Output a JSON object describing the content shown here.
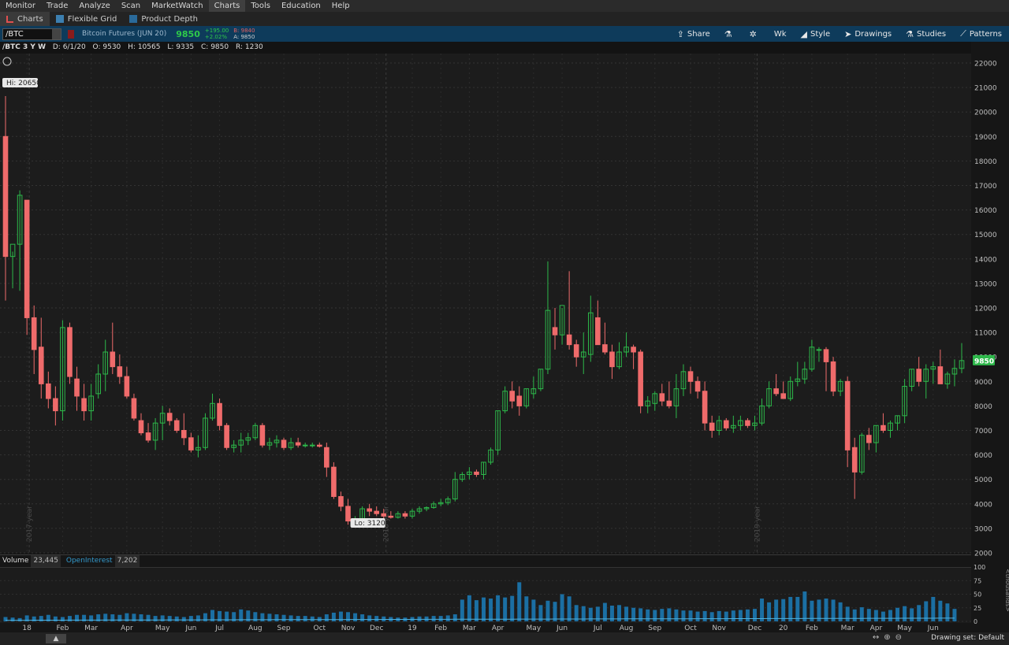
{
  "menu": [
    "Monitor",
    "Trade",
    "Analyze",
    "Scan",
    "MarketWatch",
    "Charts",
    "Tools",
    "Education",
    "Help"
  ],
  "menu_active": "Charts",
  "subtabs": [
    "Charts",
    "Flexible Grid",
    "Product Depth"
  ],
  "symbol": "/BTC",
  "description": "Bitcoin Futures (JUN 20)",
  "last_price": "9850",
  "net_change": "+195.00",
  "pct_change": "+2.02%",
  "bid": "B: 9840",
  "ask": "A: 9850",
  "toolbar": {
    "share": "Share",
    "aggregation": "Wk",
    "style": "Style",
    "drawings": "Drawings",
    "studies": "Studies",
    "patterns": "Patterns"
  },
  "info": {
    "title": "/BTC 3 Y W",
    "date": "D: 6/1/20",
    "open": "O: 9530",
    "high": "H: 10565",
    "low": "L: 9335",
    "close": "C: 9850",
    "range": "R: 1230"
  },
  "volume_label": "Volume",
  "volume_value": "23,445",
  "oi_label": "OpenInterest",
  "oi_value": "7,202",
  "drawing_set": "Drawing set: Default",
  "colors": {
    "up": "#2db84a",
    "down": "#ef6b6b",
    "volume": "#1b6fa3",
    "background": "#1c1c1c",
    "last_tag": "#2db84a"
  },
  "chart_data": {
    "type": "candlestick",
    "price_axis": {
      "min": 2000,
      "max": 22000,
      "ticks": [
        2000,
        3000,
        4000,
        5000,
        6000,
        7000,
        8000,
        9000,
        10000,
        11000,
        12000,
        13000,
        14000,
        15000,
        16000,
        17000,
        18000,
        19000,
        20000,
        21000,
        22000
      ]
    },
    "volume_axis": {
      "min": 0,
      "max": 100,
      "ticks": [
        0,
        25,
        50,
        75,
        100
      ],
      "unit_label": "<thousands>"
    },
    "time_labels": [
      "18",
      "Feb",
      "Mar",
      "Apr",
      "May",
      "Jun",
      "Jul",
      "Aug",
      "Sep",
      "Oct",
      "Nov",
      "Dec",
      "19",
      "Feb",
      "Mar",
      "Apr",
      "May",
      "Jun",
      "Jul",
      "Aug",
      "Sep",
      "Oct",
      "Nov",
      "Dec",
      "20",
      "Feb",
      "Mar",
      "Apr",
      "May",
      "Jun"
    ],
    "year_labels": [
      "2017 year",
      "2018 year",
      "2019 year"
    ],
    "annotations": {
      "high": "Hi: 20650",
      "low": "Lo: 3120",
      "last": "9850"
    },
    "candles": [
      [
        19000,
        20650,
        12300,
        14100
      ],
      [
        14100,
        14300,
        12800,
        14600
      ],
      [
        14600,
        16800,
        12700,
        16600
      ],
      [
        16400,
        16400,
        10900,
        11600
      ],
      [
        11600,
        12100,
        9300,
        10300
      ],
      [
        10400,
        11600,
        8300,
        8900
      ],
      [
        8900,
        9400,
        7900,
        8300
      ],
      [
        8300,
        8800,
        7200,
        7800
      ],
      [
        7800,
        11500,
        7400,
        11200
      ],
      [
        11200,
        11400,
        8900,
        9200
      ],
      [
        9100,
        9600,
        7800,
        8400
      ],
      [
        8300,
        8900,
        7400,
        7800
      ],
      [
        7800,
        8900,
        7400,
        8400
      ],
      [
        8500,
        9700,
        8300,
        9300
      ],
      [
        9300,
        10700,
        8600,
        10200
      ],
      [
        10200,
        11400,
        9300,
        9600
      ],
      [
        9600,
        10100,
        8900,
        9200
      ],
      [
        9200,
        9600,
        8300,
        8400
      ],
      [
        8300,
        8500,
        7400,
        7500
      ],
      [
        7400,
        7700,
        6800,
        6900
      ],
      [
        6900,
        7300,
        6500,
        6600
      ],
      [
        6600,
        7500,
        6200,
        7300
      ],
      [
        7300,
        8000,
        6600,
        7700
      ],
      [
        7700,
        7900,
        7200,
        7400
      ],
      [
        7400,
        7500,
        6900,
        7000
      ],
      [
        7000,
        7700,
        6400,
        6700
      ],
      [
        6700,
        6900,
        6100,
        6200
      ],
      [
        6200,
        6800,
        5900,
        6300
      ],
      [
        6300,
        7700,
        6200,
        7500
      ],
      [
        7500,
        8500,
        7400,
        8100
      ],
      [
        8100,
        8300,
        7000,
        7200
      ],
      [
        7200,
        7300,
        6200,
        6300
      ],
      [
        6300,
        6600,
        6100,
        6400
      ],
      [
        6400,
        6900,
        6100,
        6600
      ],
      [
        6600,
        6900,
        6400,
        6700
      ],
      [
        6700,
        7300,
        6600,
        7200
      ],
      [
        7200,
        7300,
        6300,
        6400
      ],
      [
        6400,
        6700,
        6200,
        6500
      ],
      [
        6500,
        6800,
        6300,
        6600
      ],
      [
        6600,
        6700,
        6200,
        6300
      ],
      [
        6300,
        6700,
        6200,
        6500
      ],
      [
        6500,
        6700,
        6300,
        6400
      ],
      [
        6400,
        6500,
        6300,
        6400
      ],
      [
        6400,
        6500,
        6300,
        6400
      ],
      [
        6400,
        6500,
        6300,
        6350
      ],
      [
        6300,
        6500,
        5100,
        5500
      ],
      [
        5500,
        5700,
        4200,
        4300
      ],
      [
        4300,
        4500,
        3700,
        3900
      ],
      [
        3900,
        4200,
        3150,
        3300
      ],
      [
        3300,
        3500,
        3120,
        3400
      ],
      [
        3400,
        3900,
        3300,
        3800
      ],
      [
        3800,
        4000,
        3500,
        3700
      ],
      [
        3700,
        3900,
        3500,
        3600
      ],
      [
        3600,
        3800,
        3400,
        3500
      ],
      [
        3500,
        3700,
        3400,
        3450
      ],
      [
        3450,
        3700,
        3400,
        3600
      ],
      [
        3600,
        3700,
        3400,
        3500
      ],
      [
        3500,
        3800,
        3400,
        3700
      ],
      [
        3700,
        3900,
        3600,
        3800
      ],
      [
        3800,
        3900,
        3700,
        3850
      ],
      [
        3850,
        4100,
        3800,
        4000
      ],
      [
        4000,
        4200,
        3900,
        4050
      ],
      [
        4050,
        4300,
        3950,
        4200
      ],
      [
        4200,
        5300,
        4100,
        5000
      ],
      [
        5000,
        5300,
        4900,
        5200
      ],
      [
        5200,
        5500,
        5000,
        5300
      ],
      [
        5300,
        5400,
        5100,
        5200
      ],
      [
        5200,
        5700,
        5000,
        5700
      ],
      [
        5700,
        6300,
        5600,
        6200
      ],
      [
        6200,
        7800,
        6000,
        7800
      ],
      [
        7800,
        8800,
        7700,
        8600
      ],
      [
        8600,
        9000,
        7900,
        8200
      ],
      [
        8400,
        8800,
        7600,
        8000
      ],
      [
        8000,
        8700,
        7900,
        8700
      ],
      [
        8500,
        9200,
        8300,
        8700
      ],
      [
        8700,
        9500,
        8600,
        9500
      ],
      [
        9500,
        13900,
        9300,
        11900
      ],
      [
        11200,
        12000,
        10300,
        10900
      ],
      [
        10900,
        12000,
        10500,
        12100
      ],
      [
        10900,
        13500,
        10300,
        10500
      ],
      [
        10500,
        10700,
        9600,
        10000
      ],
      [
        10000,
        11000,
        9300,
        10200
      ],
      [
        10100,
        12500,
        9800,
        11800
      ],
      [
        11600,
        12300,
        10500,
        10500
      ],
      [
        10500,
        11400,
        10100,
        10200
      ],
      [
        10200,
        10500,
        9100,
        9600
      ],
      [
        9600,
        10600,
        9500,
        10200
      ],
      [
        10200,
        11000,
        10000,
        10400
      ],
      [
        10400,
        10500,
        9500,
        10200
      ],
      [
        10200,
        10300,
        7700,
        8000
      ],
      [
        8000,
        8400,
        7700,
        8200
      ],
      [
        8100,
        8600,
        7800,
        8500
      ],
      [
        8500,
        8900,
        8000,
        8200
      ],
      [
        8200,
        9000,
        7900,
        8000
      ],
      [
        8000,
        9300,
        7500,
        8700
      ],
      [
        8700,
        9700,
        8400,
        9400
      ],
      [
        9400,
        9600,
        8500,
        9000
      ],
      [
        9000,
        9200,
        8300,
        8600
      ],
      [
        8600,
        9000,
        7000,
        7300
      ],
      [
        7300,
        7600,
        6700,
        7000
      ],
      [
        7000,
        7600,
        6800,
        7400
      ],
      [
        7400,
        7500,
        7000,
        7100
      ],
      [
        7100,
        7600,
        6900,
        7200
      ],
      [
        7200,
        7600,
        7000,
        7400
      ],
      [
        7400,
        7500,
        7100,
        7200
      ],
      [
        7200,
        7600,
        7000,
        7300
      ],
      [
        7300,
        8300,
        7200,
        8000
      ],
      [
        8000,
        9000,
        7900,
        8700
      ],
      [
        8700,
        9300,
        8400,
        8500
      ],
      [
        8500,
        9000,
        8300,
        8300
      ],
      [
        8300,
        9200,
        8200,
        9000
      ],
      [
        9000,
        9800,
        8800,
        9100
      ],
      [
        9100,
        9800,
        8900,
        9500
      ],
      [
        9500,
        10700,
        9400,
        10400
      ],
      [
        10300,
        10400,
        9800,
        10300
      ],
      [
        10300,
        10400,
        8600,
        9800
      ],
      [
        9800,
        10000,
        8400,
        8600
      ],
      [
        8600,
        9100,
        8400,
        9000
      ],
      [
        9000,
        9200,
        5500,
        6200
      ],
      [
        6300,
        6700,
        4200,
        5300
      ],
      [
        5300,
        6900,
        5200,
        6800
      ],
      [
        6800,
        7100,
        6200,
        6500
      ],
      [
        6500,
        7200,
        6100,
        7200
      ],
      [
        7200,
        7700,
        6900,
        7000
      ],
      [
        7000,
        7400,
        6700,
        7300
      ],
      [
        7300,
        7600,
        7000,
        7600
      ],
      [
        7600,
        9100,
        7300,
        8800
      ],
      [
        8800,
        9500,
        8600,
        9500
      ],
      [
        9500,
        10000,
        8800,
        9000
      ],
      [
        9000,
        9700,
        8300,
        9500
      ],
      [
        9500,
        9800,
        8900,
        9600
      ],
      [
        9600,
        10300,
        9300,
        8900
      ],
      [
        8900,
        9400,
        8700,
        9300
      ],
      [
        9300,
        9900,
        8800,
        9530
      ],
      [
        9530,
        10565,
        9335,
        9850
      ]
    ],
    "volumes": [
      8,
      7,
      6,
      11,
      9,
      10,
      12,
      9,
      8,
      10,
      12,
      12,
      11,
      13,
      14,
      13,
      12,
      15,
      14,
      13,
      12,
      10,
      11,
      10,
      9,
      8,
      10,
      11,
      15,
      21,
      19,
      18,
      17,
      22,
      20,
      17,
      15,
      14,
      13,
      12,
      11,
      10,
      10,
      9,
      8,
      13,
      16,
      18,
      17,
      15,
      13,
      11,
      10,
      9,
      8,
      7,
      7,
      8,
      9,
      9,
      10,
      10,
      11,
      13,
      40,
      48,
      39,
      44,
      42,
      48,
      44,
      47,
      72,
      46,
      40,
      30,
      38,
      36,
      50,
      46,
      30,
      28,
      25,
      27,
      34,
      29,
      30,
      27,
      25,
      24,
      22,
      21,
      23,
      24,
      22,
      20,
      20,
      18,
      19,
      17,
      19,
      18,
      20,
      21,
      22,
      23,
      42,
      35,
      40,
      41,
      45,
      45,
      55,
      38,
      40,
      42,
      40,
      35,
      27,
      22,
      26,
      23,
      21,
      18,
      21,
      25,
      28,
      24,
      30,
      37,
      45,
      38,
      33,
      23
    ]
  }
}
